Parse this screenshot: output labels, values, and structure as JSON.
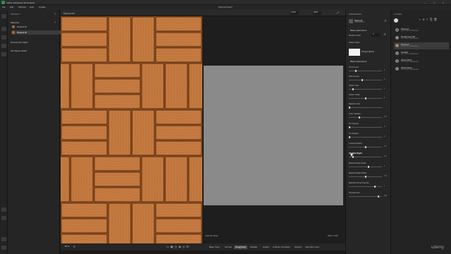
{
  "app_title": "Adobe Substance 3D Sampler",
  "window_title": "Plywood Floor*",
  "menu": [
    "File",
    "Edit",
    "Window",
    "Help",
    "Update"
  ],
  "project": {
    "header": "PROJECT",
    "materials_label": "Materials",
    "materials": [
      "Plywood 01",
      "Plywood 02"
    ],
    "env_label": "Environment lights",
    "objects_label": "3D objects (links)"
  },
  "viewport": {
    "tab_2d": "Plywood 02",
    "view_mode": "Material Only",
    "zoom": "100%",
    "resolution": "2048",
    "footer_zoom": "85 %",
    "footer_left": "Channels: Base",
    "footer_res": "2048 x 2048",
    "channels": [
      "Base Color",
      "Normal",
      "Roughness",
      "Metallic",
      "Height",
      "Ambient Occlusion",
      "Opacity",
      "Specular Level"
    ],
    "active_channel": "Roughness"
  },
  "properties": {
    "header": "PROPERTIES",
    "node_name": "Plywood",
    "node_sub": "Tools & Filters",
    "section1": "Basic parameters",
    "random_seed_label": "Random Seed",
    "random_seed_value": "0",
    "pattern_mode_label": "Pattern Mode",
    "pattern_mode_value": "Parquet (Basic)",
    "section2": "Basic parameters",
    "params": [
      {
        "label": "Tile Amount",
        "value": "4",
        "pos": 0.2
      },
      {
        "label": "Split Amount",
        "value": "3",
        "pos": 0.4
      },
      {
        "label": "Pattern Size",
        "value": "1",
        "pos": 0.1
      },
      {
        "label": "Pattern Scale",
        "value": "2",
        "pos": 0.5
      },
      {
        "label": "Material Color",
        "value": "",
        "pos": 0.0
      },
      {
        "label": "Color Variation",
        "value": "0.3",
        "pos": 0.3
      },
      {
        "label": "Tilt Intensity",
        "value": "0",
        "pos": 0.0
      },
      {
        "label": "Tilt Variation",
        "value": "0",
        "pos": 0.0
      },
      {
        "label": "Chamfer Radius",
        "value": "0.5",
        "pos": 0.5
      },
      {
        "label": "Chamfer Depth",
        "value": "0.5",
        "pos": 0.1
      },
      {
        "label": "Material Height Scale",
        "value": "1",
        "pos": 0.6
      },
      {
        "label": "Material Height Offset",
        "value": "0.5",
        "pos": 0.5
      },
      {
        "label": "Material Normal Intensity",
        "value": "1",
        "pos": 0.8
      },
      {
        "label": "Physical Size",
        "value": "200",
        "pos": 0.9
      }
    ]
  },
  "explorer": {
    "header": "LAYERS",
    "layers": [
      {
        "name": "Plywood",
        "sub": "1x1 ± Tile of Substances",
        "color": "#6b6b6b"
      },
      {
        "name": "Roughness Fill",
        "sub": "1x1 ± Tile of Substances",
        "color": "#8a8a8a"
      },
      {
        "name": "Plywood",
        "sub": "1x1 ± Tile of Substances",
        "color": "#c2834c"
      },
      {
        "name": "Scratch",
        "sub": "1x1 ± Tile of Substances",
        "color": "#777"
      },
      {
        "name": "Wood Fibre",
        "sub": "1x1 ± Tile of Substances",
        "color": "#8d6a4b"
      },
      {
        "name": "Wood Fibre",
        "sub": "1x1 ± Tile of Substances",
        "color": "#7a7a7a"
      }
    ]
  },
  "watermark": "udemy",
  "colors": {
    "wood": "#c27a3f",
    "wood_dark": "#8a4f24",
    "grey": "#8a8a8a",
    "panel": "#262626"
  }
}
